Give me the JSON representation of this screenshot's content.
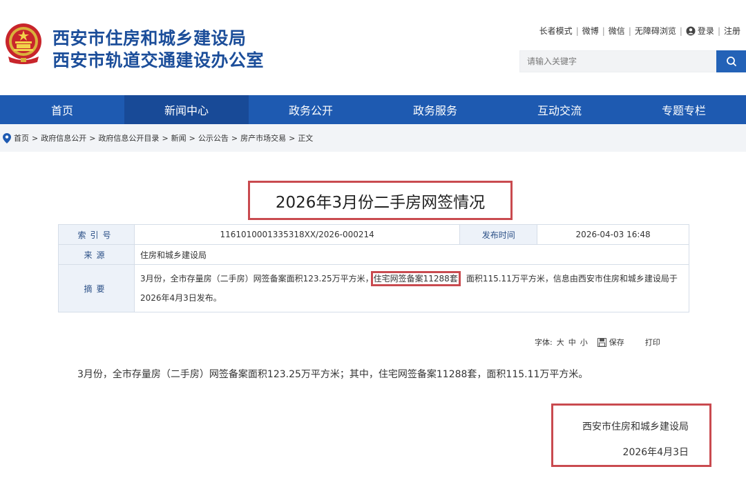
{
  "header": {
    "title_line1": "西安市住房和城乡建设局",
    "title_line2": "西安市轨道交通建设办公室",
    "links": [
      "长者模式",
      "微博",
      "微信",
      "无障碍浏览"
    ],
    "login": "登录",
    "register": "注册",
    "search_placeholder": "请输入关键字",
    "colors": {
      "brand_blue": "#1c4e9a",
      "nav_blue": "#1e5ab1",
      "highlight_red": "#c94a4f"
    }
  },
  "nav": {
    "items": [
      "首页",
      "新闻中心",
      "政务公开",
      "政务服务",
      "互动交流",
      "专题专栏"
    ],
    "active": "新闻中心"
  },
  "breadcrumb": [
    "首页",
    "政府信息公开",
    "政府信息公开目录",
    "新闻",
    "公示公告",
    "房产市场交易",
    "正文"
  ],
  "article": {
    "title": "2026年3月份二手房网签情况",
    "meta": {
      "index_label": "索引号",
      "index_value": "1161010001335318XX/2026-000214",
      "date_label": "发布时间",
      "date_value": "2026-04-03 16:48",
      "source_label": "来源",
      "source_value": "住房和城乡建设局",
      "summary_label": "摘要",
      "summary_part1": "3月份，全市存量房（二手房）网签备案面积123.25万平方米，",
      "summary_highlight": "住宅网签备案11288套",
      "summary_part2": "，面积115.11万平方米，信息由西安市住房和城乡建设局于2026年4月3日发布。"
    },
    "tools": {
      "font_label": "字体:",
      "font_large": "大",
      "font_medium": "中",
      "font_small": "小",
      "save": "保存",
      "print": "打印"
    },
    "body": "3月份，全市存量房（二手房）网签备案面积123.25万平方米；其中，住宅网签备案11288套，面积115.11万平方米。",
    "signature_org": "西安市住房和城乡建设局",
    "signature_date": "2026年4月3日"
  }
}
